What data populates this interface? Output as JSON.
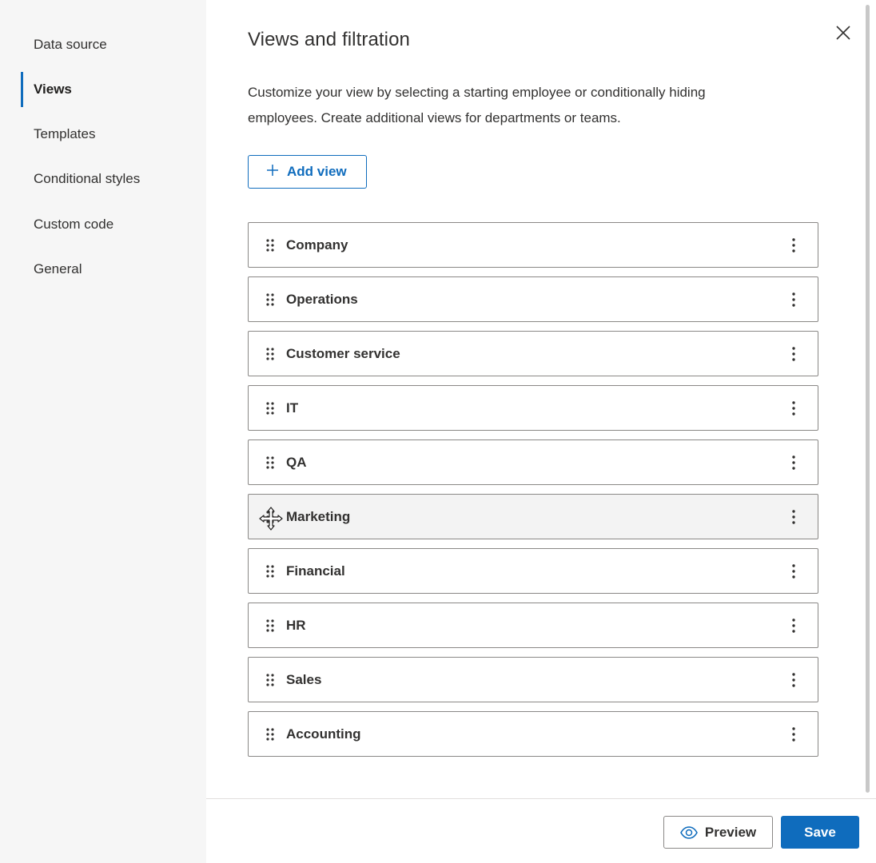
{
  "sidebar": {
    "items": [
      {
        "label": "Data source",
        "active": false
      },
      {
        "label": "Views",
        "active": true
      },
      {
        "label": "Templates",
        "active": false
      },
      {
        "label": "Conditional styles",
        "active": false
      },
      {
        "label": "Custom code",
        "active": false
      },
      {
        "label": "General",
        "active": false
      }
    ]
  },
  "main": {
    "title": "Views and filtration",
    "description": "Customize your view by selecting a starting employee or conditionally hiding employees. Create additional views for departments or teams.",
    "add_view_label": "Add view",
    "close_icon": "close-icon",
    "views": [
      {
        "name": "Company"
      },
      {
        "name": "Operations"
      },
      {
        "name": "Customer service"
      },
      {
        "name": "IT"
      },
      {
        "name": "QA"
      },
      {
        "name": "Marketing",
        "hovered": true
      },
      {
        "name": "Financial"
      },
      {
        "name": "HR"
      },
      {
        "name": "Sales"
      },
      {
        "name": "Accounting"
      }
    ]
  },
  "footer": {
    "preview_label": "Preview",
    "save_label": "Save"
  },
  "colors": {
    "accent": "#0f6cbd",
    "sidebar_bg": "#f6f6f6",
    "border": "#8a8886"
  }
}
